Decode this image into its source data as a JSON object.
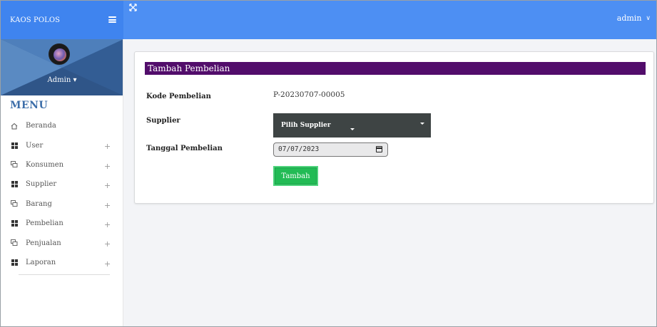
{
  "header": {
    "brand": "KAOS POLOS",
    "user_label": "admin",
    "user_chevron": "∨"
  },
  "sidebar": {
    "profile_name": "Admin",
    "profile_caret": "▾",
    "menu_title": "MENU",
    "items": [
      {
        "label": "Beranda",
        "icon": "home-icon",
        "expandable": false
      },
      {
        "label": "User",
        "icon": "grid-icon",
        "expandable": true
      },
      {
        "label": "Konsumen",
        "icon": "chat-icon",
        "expandable": true
      },
      {
        "label": "Supplier",
        "icon": "grid-icon",
        "expandable": true
      },
      {
        "label": "Barang",
        "icon": "chat-icon",
        "expandable": true
      },
      {
        "label": "Pembelian",
        "icon": "grid-icon",
        "expandable": true
      },
      {
        "label": "Penjualan",
        "icon": "chat-icon",
        "expandable": true
      },
      {
        "label": "Laporan",
        "icon": "grid-icon",
        "expandable": true
      }
    ],
    "plus": "+"
  },
  "form": {
    "title": "Tambah Pembelian",
    "kode_label": "Kode Pembelian",
    "kode_value": "P-20230707-00005",
    "supplier_label": "Supplier",
    "supplier_placeholder": "Pilih Supplier",
    "tanggal_label": "Tanggal Pembelian",
    "tanggal_value": "07/07/2023",
    "submit_label": "Tambah"
  },
  "colors": {
    "topbar": "#4d8ff3",
    "header_bar": "#520d6b",
    "button": "#22bb55",
    "select": "#3e4444",
    "menu_title": "#3c6ea9"
  }
}
